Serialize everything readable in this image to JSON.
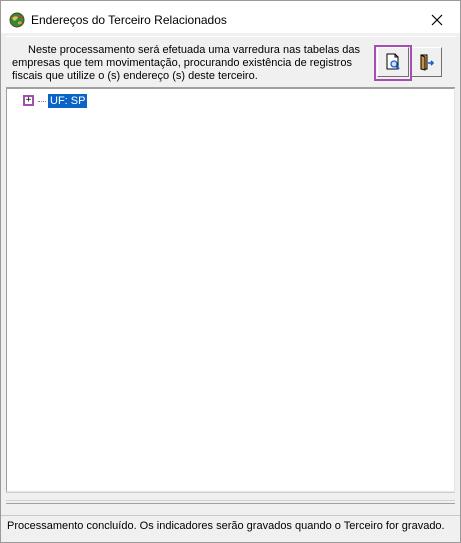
{
  "window": {
    "title": "Endereços do Terceiro Relacionados",
    "app_icon": "globe-icon",
    "close_icon": "close-icon"
  },
  "toolbar": {
    "info_line1": "Neste processamento será efetuada uma varredura nas tabelas das",
    "info_line2": "empresas que tem movimentação, procurando existência de registros",
    "info_line3": "fiscais que utilize o (s) endereço (s) deste terceiro.",
    "preview_icon": "document-search-icon",
    "exit_icon": "exit-door-icon"
  },
  "tree": {
    "nodes": [
      {
        "label": "UF: SP",
        "expander": "+"
      }
    ]
  },
  "status": {
    "text": "Processamento concluído. Os indicadores serão gravados quando o Terceiro for gravado."
  },
  "colors": {
    "highlight": "#a24fb0",
    "selection": "#0a64c8"
  }
}
